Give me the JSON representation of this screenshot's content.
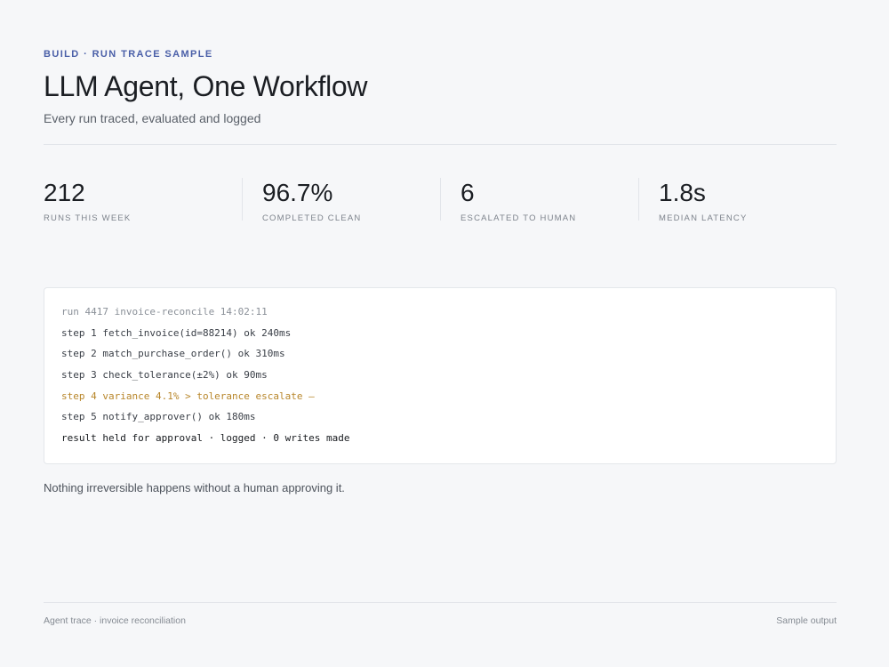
{
  "header": {
    "eyebrow": "BUILD · RUN TRACE SAMPLE",
    "title": "LLM Agent, One Workflow",
    "subtitle": "Every run traced, evaluated and logged"
  },
  "stats": [
    {
      "value": "212",
      "label": "RUNS THIS WEEK"
    },
    {
      "value": "96.7%",
      "label": "COMPLETED CLEAN"
    },
    {
      "value": "6",
      "label": "ESCALATED TO HUMAN"
    },
    {
      "value": "1.8s",
      "label": "MEDIAN LATENCY"
    }
  ],
  "trace": {
    "lines": [
      {
        "text": "run 4417 invoice-reconcile 14:02:11",
        "kind": "head"
      },
      {
        "text": "step 1 fetch_invoice(id=88214) ok 240ms",
        "kind": "ok"
      },
      {
        "text": "step 2 match_purchase_order() ok 310ms",
        "kind": "ok"
      },
      {
        "text": "step 3 check_tolerance(±2%) ok 90ms",
        "kind": "ok"
      },
      {
        "text": "step 4 variance 4.1% > tolerance escalate –",
        "kind": "warn"
      },
      {
        "text": "step 5 notify_approver() ok 180ms",
        "kind": "ok"
      },
      {
        "text": "result held for approval · logged · 0 writes made",
        "kind": "result"
      }
    ],
    "colors": {
      "warn": "#b8862a"
    }
  },
  "note": "Nothing irreversible happens without a human approving it.",
  "footer": {
    "left": "Agent trace · invoice reconciliation",
    "right": "Sample output"
  }
}
